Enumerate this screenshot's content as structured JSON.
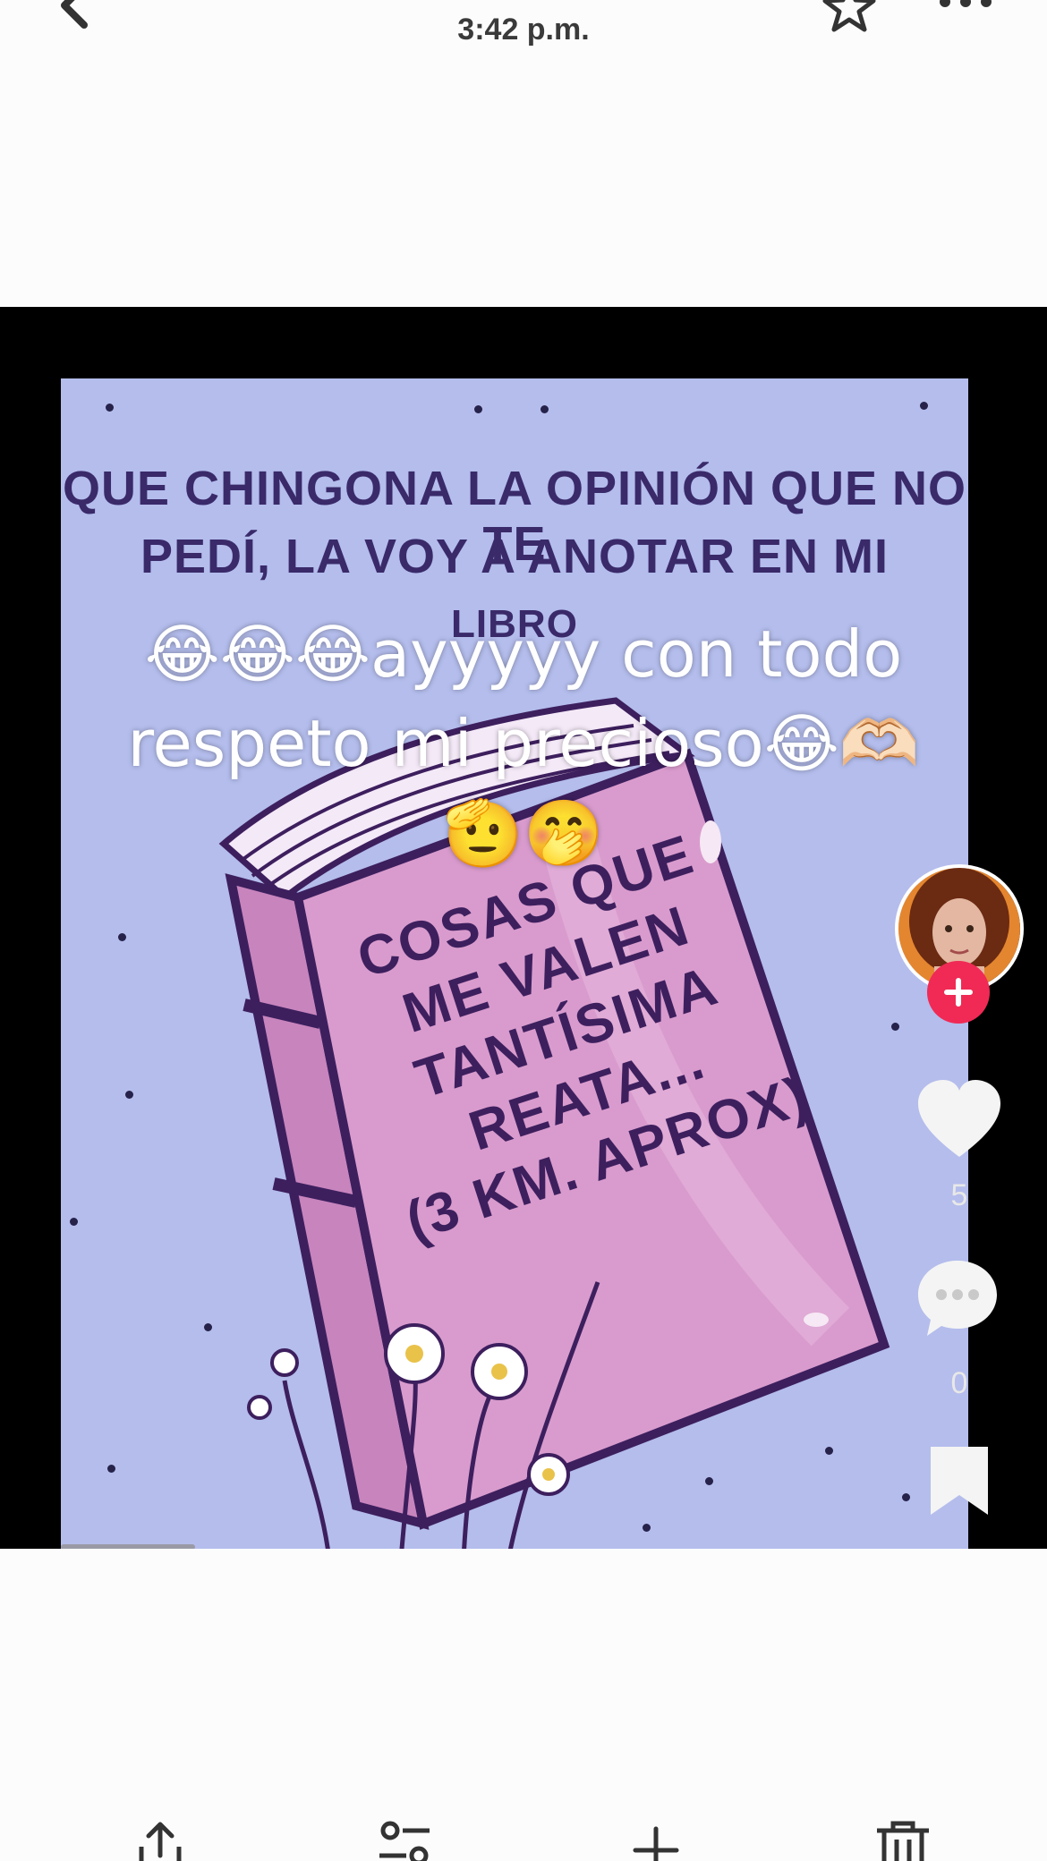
{
  "header": {
    "timestamp": "3:42 p.m.",
    "back_icon": "chevron-left-icon",
    "favorite_icon": "star-icon",
    "more_icon": "more-horizontal-icon"
  },
  "media": {
    "poster_lines": [
      "QUE CHINGONA LA OPINIÓN QUE NO TE",
      "PEDÍ, LA VOY A ANOTAR EN MI",
      "LIBRO"
    ],
    "book_lines": [
      "COSAS QUE",
      "ME VALEN",
      "TANTÍSIMA",
      "REATA...",
      "(3 KM. APROX)"
    ],
    "caption_lines": [
      "😂😂😂ayyyyy con todo",
      "respeto mi  precioso😂🫶🏻",
      "🫡🤭"
    ],
    "colors": {
      "poster_bg": "#b4bdec",
      "book_cover": "#d99bcd",
      "book_spine": "#c884bd",
      "ink": "#3d1f5e"
    }
  },
  "rail": {
    "follow_icon": "plus-icon",
    "like_icon": "heart-icon",
    "like_count": "5",
    "comment_icon": "comment-icon",
    "comment_count": "0",
    "bookmark_icon": "bookmark-icon",
    "accent": "#f02a55"
  },
  "toolbar": {
    "items": [
      {
        "icon": "share-icon"
      },
      {
        "icon": "adjust-icon"
      },
      {
        "icon": "add-icon"
      },
      {
        "icon": "trash-icon"
      }
    ]
  }
}
